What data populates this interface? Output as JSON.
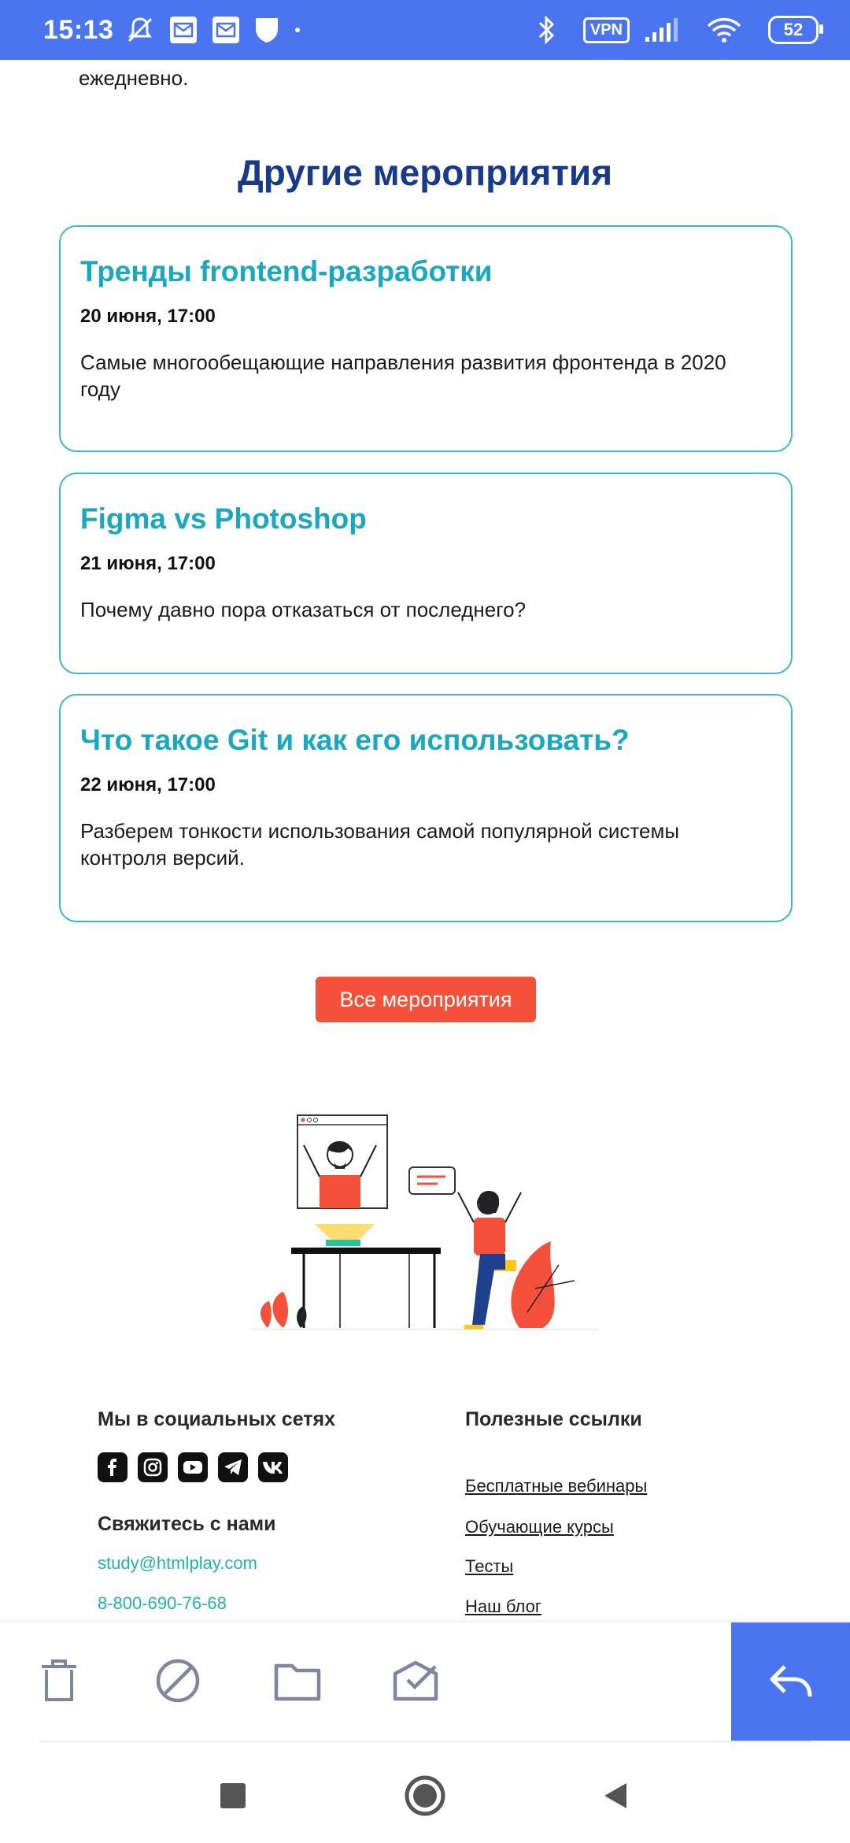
{
  "status_bar": {
    "time": "15:13",
    "vpn": "VPN",
    "battery": "52"
  },
  "article": {
    "tail_text": "ежедневно."
  },
  "events": {
    "title": "Другие мероприятия",
    "items": [
      {
        "title": "Тренды frontend-разработки",
        "date": "20 июня, 17:00",
        "desc": "Самые многообещающие направления развития фронтенда в 2020 году"
      },
      {
        "title": "Figma vs Photoshop",
        "date": "21 июня, 17:00",
        "desc": "Почему давно пора отказаться от последнего?"
      },
      {
        "title": "Что такое Git и как его использовать?",
        "date": "22 июня, 17:00",
        "desc": "Разберем тонкости использования самой популярной системы контроля версий."
      }
    ],
    "all_button": "Все мероприятия"
  },
  "footer": {
    "social_title": "Мы в социальных сетях",
    "social_icons": [
      "facebook-icon",
      "instagram-icon",
      "youtube-icon",
      "telegram-icon",
      "vk-icon"
    ],
    "contact_title": "Свяжитесь с нами",
    "email": "study@htmlplay.com",
    "phone": "8-800-690-76-68",
    "links_title": "Полезные ссылки",
    "links": [
      "Бесплатные вебинары",
      "Обучающие курсы",
      "Тесты",
      "Наш блог"
    ]
  },
  "action_bar": {
    "icons": [
      "trash-icon",
      "block-icon",
      "folder-icon",
      "mark-done-icon",
      "reply-icon"
    ]
  },
  "colors": {
    "accent": "#4a74f0",
    "heading": "#173a8d",
    "card_title": "#17a9c2",
    "card_border": "#3cb7cc",
    "button": "#f5503a",
    "link_green": "#1fb6a8"
  }
}
